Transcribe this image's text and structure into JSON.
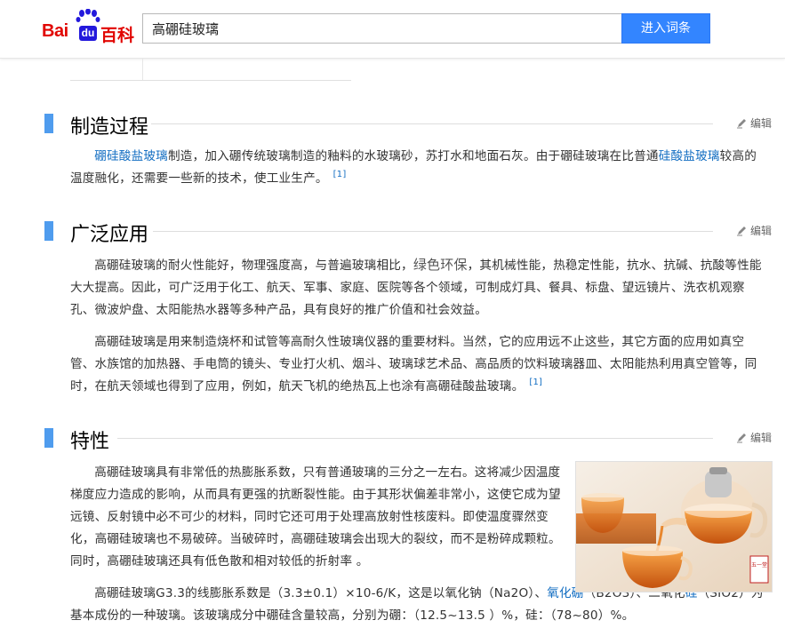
{
  "header": {
    "logo_bai": "Bai",
    "logo_du": "du",
    "logo_baike": "百科",
    "search_value": "高硼硅玻璃",
    "enter_button": "进入词条"
  },
  "sections": [
    {
      "title": "制造过程",
      "edit_label": "编辑",
      "paragraphs": [
        {
          "link": "硼硅酸盐玻璃",
          "text1": "制造，加入硼传统玻璃制造的釉料的水玻璃砂，苏打水和地面石灰。由于硼硅玻璃在比普通",
          "link2": "硅酸盐玻璃",
          "text2": "较高的温度融化，还需要一些新的技术，使工业生产。",
          "ref": "[1]"
        }
      ]
    },
    {
      "title": "广泛应用",
      "edit_label": "编辑",
      "paragraphs": [
        {
          "text1": "高硼硅玻璃的耐火性能好，物理强度高，与普遍玻璃相比，",
          "highlight": "绿色环保",
          "text2": "，其机械性能，热稳定性能，抗水、抗碱、抗酸等性能大大提高。因此，可广泛用于化工、航天、军事、家庭、医院等各个领域，可制成灯具、餐具、标盘、望远镜片、洗衣机观察孔、微波炉盘、太阳能热水器等多种产品，具有良好的推广价值和社会效益。"
        },
        {
          "text1": "高硼硅玻璃是用来制造烧杯和试管等高耐久性玻璃仪器的重要材料。当然，它的应用远不止这些，其它方面的应用如真空管、水族馆的加热器、手电筒的镜头、专业打火机、烟斗、玻璃球艺术品、高品质的饮料玻璃器皿、太阳能热利用真空管等，同时，在航天领域也得到了应用，例如，航天飞机的绝热瓦上也涂有高硼硅酸盐玻璃。",
          "ref": "[1]"
        }
      ]
    },
    {
      "title": "特性",
      "edit_label": "编辑",
      "paragraphs": [
        {
          "text1": "高硼硅玻璃具有非常低的热膨胀系数，只有普通玻璃的三分之一左右。这将减少因温度梯度应力造成的影响，从而具有更强的抗断裂性能。由于其形状偏差非常小，这使它成为望远镜、反射镜中必不可少的材料，同时它还可用于处理高放射性核废料。即使温度骤然变化，高硼硅玻璃也不易破碎。当破碎时，高硼硅玻璃会出现大的裂纹，而不是粉碎成颗粒。同时，高硼硅玻璃还具有低色散和相对较低的折射率 。"
        },
        {
          "text1": "高硼硅玻璃G3.3的线膨胀系数是（3.3±0.1）×10-6/K，这是以氧化钠（Na2O）、",
          "link": "氧化硼",
          "text2": "（B2O3）、二氧化",
          "link2": "硅",
          "text3": "（SIO2）为基本成份的一种玻璃。该玻璃成分中硼硅含量较高，分别为硼：（12.5~13.5 ）%，硅：（78~80）%。"
        }
      ]
    }
  ],
  "figure": {
    "seal_text": "五一堂"
  },
  "colors": {
    "accent_blue": "#3385ff",
    "section_mark": "#4f9cee",
    "link": "#136ec2",
    "logo_red": "#e10602",
    "logo_blue": "#2319dc"
  }
}
